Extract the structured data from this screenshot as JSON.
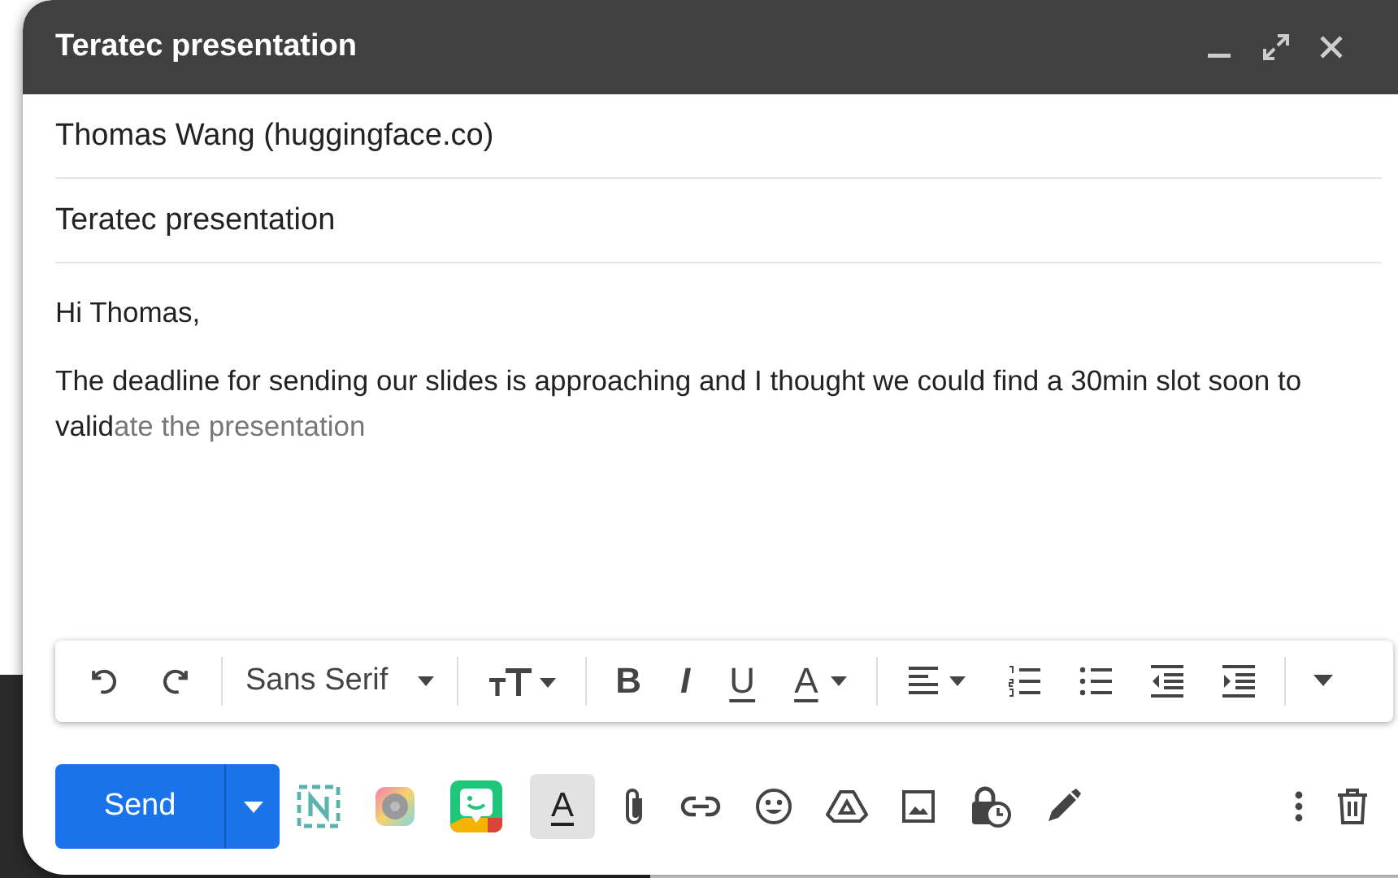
{
  "window": {
    "title": "Teratec presentation"
  },
  "recipients": "Thomas Wang (huggingface.co)",
  "subject": "Teratec presentation",
  "body": [
    {
      "typed": "Hi Thomas,"
    },
    {
      "typed": "The deadline for sending our slides is approaching and I thought we could find a 30min slot soon to valid",
      "suggestion": "ate the presentation"
    }
  ],
  "format_toolbar": [
    {
      "kind": "undo"
    },
    {
      "kind": "redo"
    },
    {
      "kind": "sep"
    },
    {
      "kind": "font",
      "label": "Sans Serif"
    },
    {
      "kind": "sep"
    },
    {
      "kind": "size"
    },
    {
      "kind": "sep"
    },
    {
      "kind": "bold",
      "glyph": "B"
    },
    {
      "kind": "italic",
      "glyph": "I"
    },
    {
      "kind": "underline",
      "glyph": "U"
    },
    {
      "kind": "color",
      "glyph": "A"
    },
    {
      "kind": "sep"
    },
    {
      "kind": "align"
    },
    {
      "kind": "numbered"
    },
    {
      "kind": "bulleted"
    },
    {
      "kind": "outdent"
    },
    {
      "kind": "indent"
    },
    {
      "kind": "sep"
    },
    {
      "kind": "more"
    }
  ],
  "send_button": {
    "label": "Send"
  },
  "bottom_tools": [
    {
      "kind": "addon-n"
    },
    {
      "kind": "addon-circle"
    },
    {
      "kind": "addon-bitmoji"
    },
    {
      "kind": "formatting",
      "glyph": "A",
      "on": true
    },
    {
      "kind": "attach"
    },
    {
      "kind": "link"
    },
    {
      "kind": "emoji"
    },
    {
      "kind": "drive"
    },
    {
      "kind": "photo"
    },
    {
      "kind": "confidential"
    },
    {
      "kind": "signature"
    }
  ]
}
